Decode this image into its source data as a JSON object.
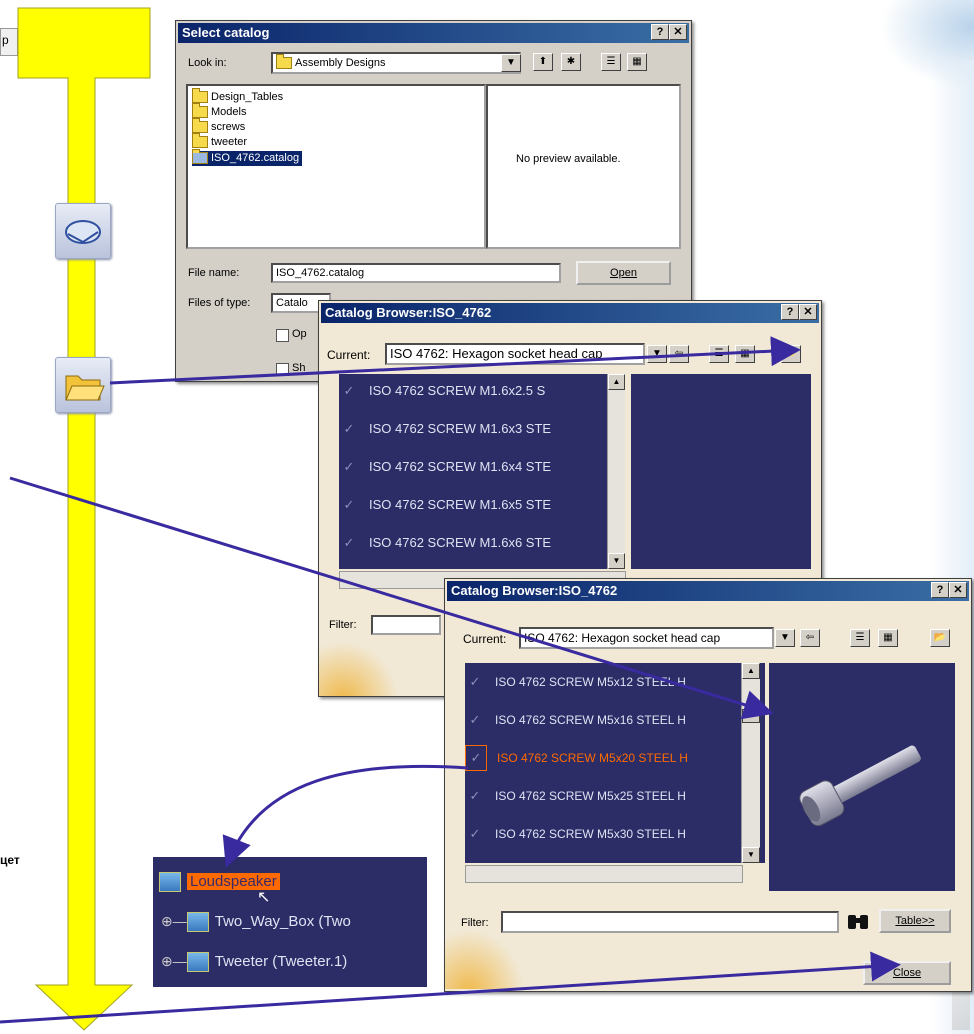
{
  "left_fragments": {
    "top_fragment": "р",
    "mid_fragment": "цет"
  },
  "select_catalog": {
    "title": "Select catalog",
    "look_in_label": "Look in:",
    "look_in_value": "Assembly Designs",
    "files": [
      "Design_Tables",
      "Models",
      "screws",
      "tweeter",
      "ISO_4762.catalog"
    ],
    "preview_text": "No preview available.",
    "file_name_label": "File name:",
    "file_name_value": "ISO_4762.catalog",
    "files_of_type_label": "Files of type:",
    "files_of_type_value": "Catalo",
    "open_button": "Open",
    "option_fragment_1": "Op",
    "option_fragment_2": "Sh"
  },
  "catalog_browser_1": {
    "title": "Catalog Browser:ISO_4762",
    "current_label": "Current:",
    "current_value": "ISO 4762: Hexagon socket head cap",
    "items": [
      "ISO 4762 SCREW M1.6x2.5 S",
      "ISO 4762 SCREW M1.6x3 STE",
      "ISO 4762 SCREW M1.6x4 STE",
      "ISO 4762 SCREW M1.6x5 STE",
      "ISO 4762 SCREW M1.6x6 STE"
    ],
    "filter_label": "Filter:"
  },
  "catalog_browser_2": {
    "title": "Catalog Browser:ISO_4762",
    "current_label": "Current:",
    "current_value": "ISO 4762: Hexagon socket head cap",
    "items": [
      "ISO 4762 SCREW M5x12 STEEL H",
      "ISO 4762 SCREW M5x16 STEEL H",
      "ISO 4762 SCREW M5x20 STEEL H",
      "ISO 4762 SCREW M5x25 STEEL H",
      "ISO 4762 SCREW M5x30 STEEL H"
    ],
    "selected_index": 2,
    "filter_label": "Filter:",
    "table_button": "Table>>",
    "close_button": "Close"
  },
  "spec_tree": {
    "items": [
      {
        "label": "Loudspeaker",
        "icon": "product-icon"
      },
      {
        "label": "Two_Way_Box (Two",
        "icon": "product-icon"
      },
      {
        "label": "Tweeter (Tweeter.1)",
        "icon": "product-icon"
      }
    ]
  },
  "colors": {
    "yellow_arrow": "#ffff00",
    "flow_arrow": "#3a2aa0",
    "panel_dark": "#2c2c66",
    "selected_orange": "#ff6a00",
    "title_bar": "#0a246a"
  }
}
